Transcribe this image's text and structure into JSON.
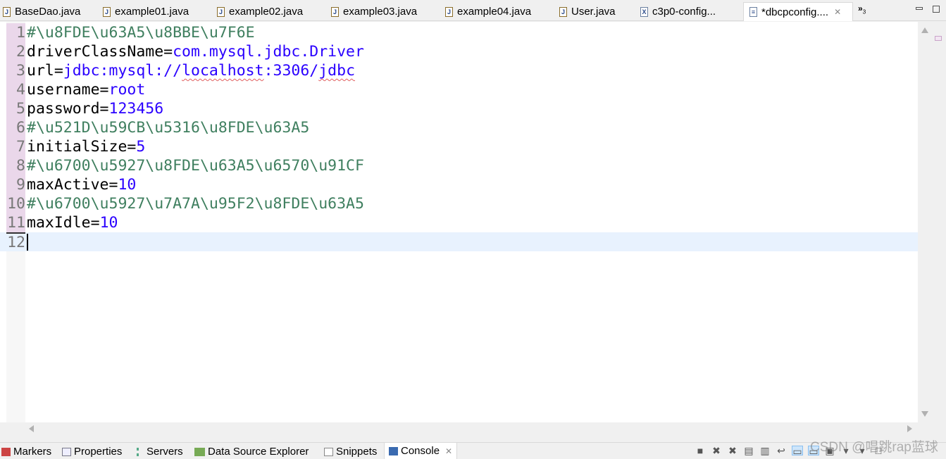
{
  "tabs": [
    {
      "label": "BaseDao.java",
      "icon": "java-file-icon"
    },
    {
      "label": "example01.java",
      "icon": "java-file-icon"
    },
    {
      "label": "example02.java",
      "icon": "java-file-icon"
    },
    {
      "label": "example03.java",
      "icon": "java-file-icon"
    },
    {
      "label": "example04.java",
      "icon": "java-file-icon"
    },
    {
      "label": "User.java",
      "icon": "java-file-icon"
    },
    {
      "label": "c3p0-config...",
      "icon": "xml-file-icon"
    },
    {
      "label": "*dbcpconfig....",
      "icon": "text-file-icon",
      "active": true
    }
  ],
  "more_tabs": "»",
  "more_tabs_count": "3",
  "editor": {
    "lines": [
      {
        "n": "1",
        "key": "#\\u8FDE\\u63A5\\u8BBE\\u7F6E",
        "val": "",
        "type": "comment"
      },
      {
        "n": "2",
        "key": "driverClassName=",
        "val": "com.mysql.jdbc.Driver"
      },
      {
        "n": "3",
        "key": "url=",
        "val": "jdbc:mysql://",
        "sq1": "localhost",
        "mid": ":3306/",
        "sq2": "jdbc"
      },
      {
        "n": "4",
        "key": "username=",
        "val": "root"
      },
      {
        "n": "5",
        "key": "password=",
        "val": "123456"
      },
      {
        "n": "6",
        "key": "#\\u521D\\u59CB\\u5316\\u8FDE\\u63A5",
        "val": "",
        "type": "comment"
      },
      {
        "n": "7",
        "key": "initialSize=",
        "val": "5"
      },
      {
        "n": "8",
        "key": "#\\u6700\\u5927\\u8FDE\\u63A5\\u6570\\u91CF",
        "val": "",
        "type": "comment"
      },
      {
        "n": "9",
        "key": "maxActive=",
        "val": "10"
      },
      {
        "n": "10",
        "key": "#\\u6700\\u5927\\u7A7A\\u95F2\\u8FDE\\u63A5",
        "val": "",
        "type": "comment"
      },
      {
        "n": "11",
        "key": "maxIdle=",
        "val": "10"
      },
      {
        "n": "12",
        "key": "",
        "val": "",
        "current": true
      }
    ]
  },
  "bottom_tabs": [
    {
      "label": "Markers",
      "icon": "markers-icon"
    },
    {
      "label": "Properties",
      "icon": "properties-icon"
    },
    {
      "label": "Servers",
      "icon": "servers-icon"
    },
    {
      "label": "Data Source Explorer",
      "icon": "data-source-icon"
    },
    {
      "label": "Snippets",
      "icon": "snippets-icon"
    },
    {
      "label": "Console",
      "icon": "console-icon",
      "active": true
    }
  ],
  "watermark": "CSDN @唱跳rap蓝球",
  "colors": {
    "key": "#000000",
    "value": "#2a00ff",
    "comment": "#3f7f5f",
    "current_line": "#e8f2fe",
    "gutter": "#ead7ea"
  }
}
